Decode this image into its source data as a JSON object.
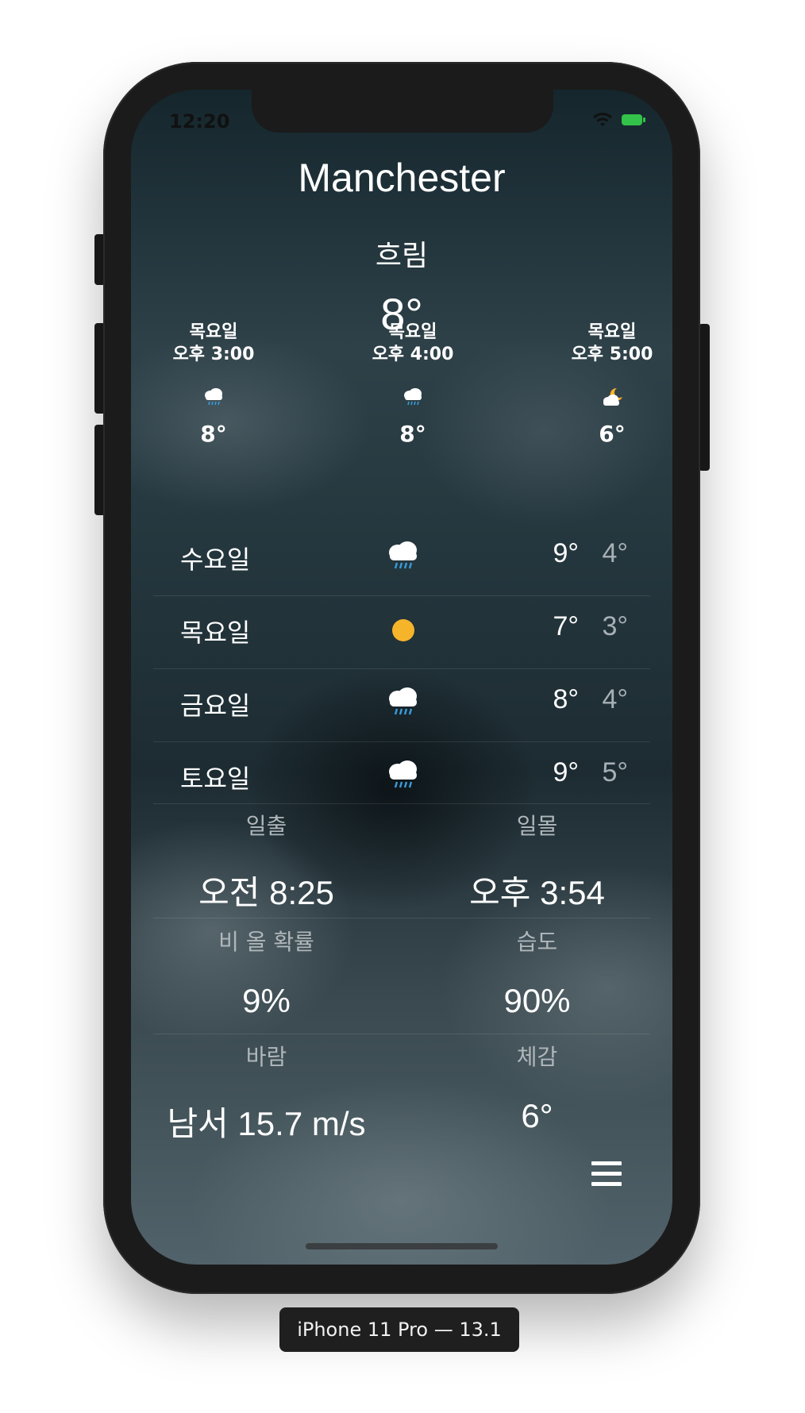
{
  "status_bar": {
    "time": "12:20",
    "wifi_icon": "wifi-icon",
    "battery_icon": "battery-charging-icon",
    "battery_color": "#33c24a"
  },
  "header": {
    "city": "Manchester",
    "condition": "흐림",
    "temperature": "8°"
  },
  "hourly": [
    {
      "day": "목요일",
      "time": "오후 3:00",
      "icon": "cloud-rain-icon",
      "temp": "8°"
    },
    {
      "day": "목요일",
      "time": "오후 4:00",
      "icon": "cloud-rain-icon",
      "temp": "8°"
    },
    {
      "day": "목요일",
      "time": "오후 5:00",
      "icon": "partly-cloudy-night-icon",
      "temp": "6°"
    }
  ],
  "daily": [
    {
      "day": "수요일",
      "icon": "cloud-rain-icon",
      "high": "9°",
      "low": "4°"
    },
    {
      "day": "목요일",
      "icon": "sun-icon",
      "high": "7°",
      "low": "3°"
    },
    {
      "day": "금요일",
      "icon": "cloud-rain-icon",
      "high": "8°",
      "low": "4°"
    },
    {
      "day": "토요일",
      "icon": "cloud-rain-icon",
      "high": "9°",
      "low": "5°"
    }
  ],
  "details": {
    "sunrise": {
      "label": "일출",
      "value": "오전 8:25"
    },
    "sunset": {
      "label": "일몰",
      "value": "오후 3:54"
    },
    "rain_chance": {
      "label": "비 올 확률",
      "value": "9%"
    },
    "humidity": {
      "label": "습도",
      "value": "90%"
    },
    "wind": {
      "label": "바람",
      "value": "남서 15.7 m/s"
    },
    "feels_like": {
      "label": "체감",
      "value": "6°"
    }
  },
  "menu": {
    "icon": "hamburger-menu-icon"
  },
  "device_label": "iPhone 11 Pro — 13.1",
  "colors": {
    "sun": "#f6b42b",
    "rain": "#3a9bd8",
    "low_temp": "#a7b0b4"
  }
}
